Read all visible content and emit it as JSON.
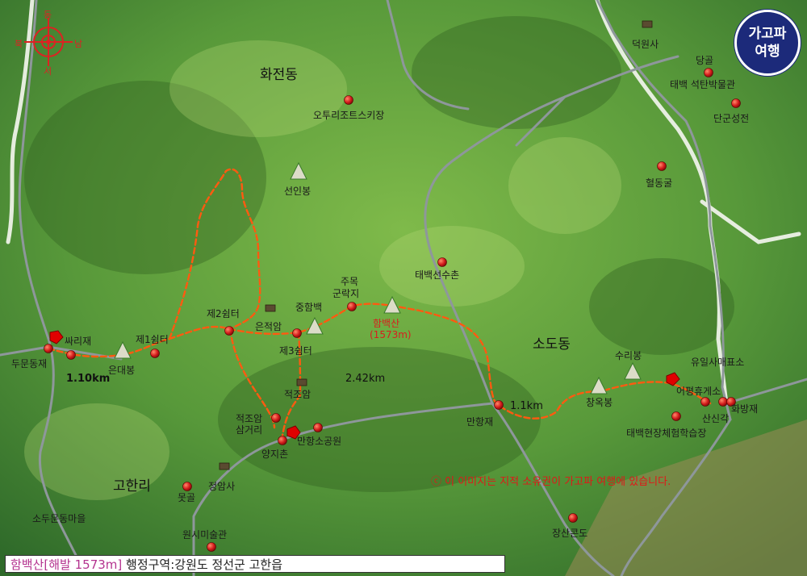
{
  "badge": {
    "line1": "가고파",
    "line2": "여행"
  },
  "compass": {
    "n": "동",
    "s": "서",
    "w": "북",
    "e": "남"
  },
  "regions": {
    "hwajeon": "화전동",
    "sodo": "소도동",
    "gohan": "고한리"
  },
  "places": {
    "deokwonsa": "덕원사",
    "danggol": "당골",
    "coal_museum": "태백 석탄박물관",
    "dangunseongjeon": "단군성전",
    "hyeoldonggul": "혈동굴",
    "ohri_resort": "오투리조트스키장",
    "seonin": "선인봉",
    "taebaek_athletes": "태백선수촌",
    "jumok": "주목",
    "gunrakji": "군락지",
    "junghambaek": "중함백",
    "eunjeokam": "은적암",
    "shelter2": "제2쉼터",
    "shelter1": "제1쉼터",
    "shelter3": "제3쉼터",
    "ssarijae": "싸리재",
    "dumundongjae": "두문동재",
    "eundaebong": "은대봉",
    "jeokjoam": "적조암",
    "jeokjoam_junction_1": "적조암",
    "jeokjoam_junction_2": "삼거리",
    "yangjichon": "양지촌",
    "manhang_park": "만항소공원",
    "manhangjae": "만항재",
    "surirbong": "수리봉",
    "changokbong": "창옥봉",
    "eopyeong": "어평휴게소",
    "yuil": "유일사매표소",
    "hwabangjae": "화방재",
    "sansingak": "산신각",
    "experience": "태백현장체험학습장",
    "jeongamsa": "정암사",
    "motgol": "못골",
    "wonsi": "원시미술관",
    "sodumun": "소두문동마을",
    "jangsan": "장산콘도"
  },
  "peak": {
    "name": "함백산",
    "elevation": "(1573m)"
  },
  "distances": {
    "d1": "1.10km",
    "d2": "2.42km",
    "d3": "1.1km"
  },
  "copyright": "ⓒ 이 이미지는 지적 소유권이 가고파 여행에 있습니다.",
  "infobar": {
    "title": "함백산[해발 1573m]",
    "admin": " 행정구역:강원도 정선군 고한읍"
  },
  "colors": {
    "trail": "#ff5a10",
    "marker": "#d41c1c",
    "road": "#9aa4a8",
    "badge": "#1c2a7a"
  }
}
